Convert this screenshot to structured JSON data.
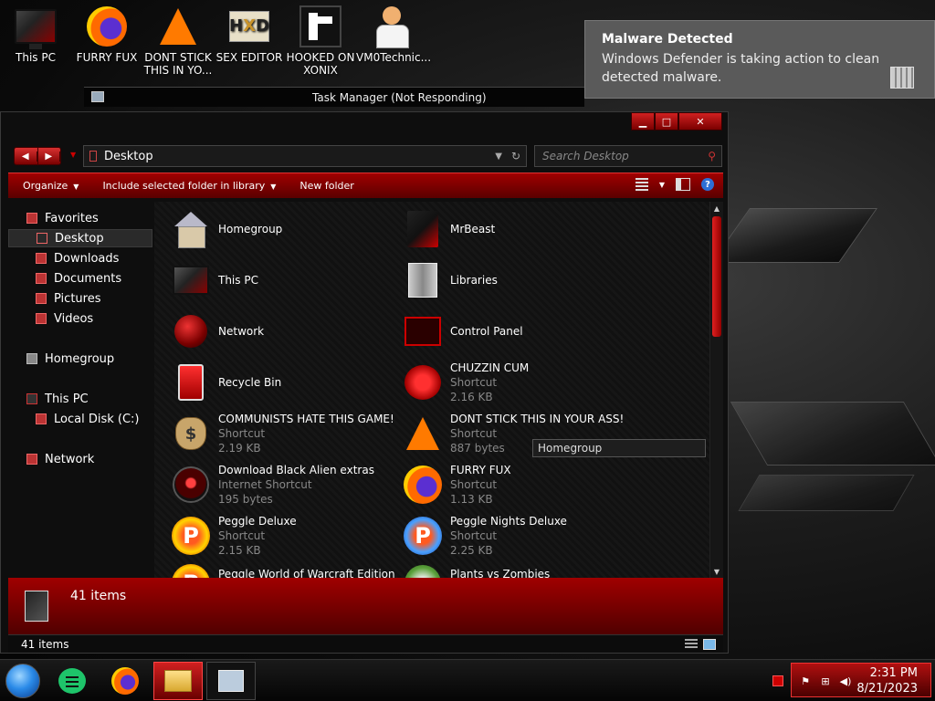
{
  "desktop": {
    "icons": [
      {
        "label": "This PC",
        "icon": "monitor-icon"
      },
      {
        "label": "FURRY FUX",
        "icon": "firefox-icon"
      },
      {
        "label": "DONT STICK THIS IN YO...",
        "icon": "vlc-cone-icon"
      },
      {
        "label": "SEX EDITOR",
        "icon": "hxd-icon"
      },
      {
        "label": "HOOKED ON XONIX",
        "icon": "game-icon"
      },
      {
        "label": "VM0Technic...",
        "icon": "doctor-icon"
      }
    ]
  },
  "notification": {
    "title": "Malware Detected",
    "body": "Windows Defender is taking action to clean detected malware."
  },
  "task_manager": {
    "title": "Task Manager (Not Responding)"
  },
  "explorer": {
    "address": "Desktop",
    "search_placeholder": "Search Desktop",
    "commands": {
      "organize": "Organize",
      "include": "Include selected folder in library",
      "new_folder": "New folder"
    },
    "nav": {
      "favorites": "Favorites",
      "desktop": "Desktop",
      "downloads": "Downloads",
      "documents": "Documents",
      "pictures": "Pictures",
      "videos": "Videos",
      "homegroup": "Homegroup",
      "this_pc": "This PC",
      "local_disk": "Local Disk (C:)",
      "network": "Network"
    },
    "items": [
      {
        "name": "Homegroup",
        "type": "",
        "size": "",
        "icon": "homegroup-icon"
      },
      {
        "name": "MrBeast",
        "type": "",
        "size": "",
        "icon": "mrbeast-icon"
      },
      {
        "name": "This PC",
        "type": "",
        "size": "",
        "icon": "monitor-icon"
      },
      {
        "name": "Libraries",
        "type": "",
        "size": "",
        "icon": "libraries-icon"
      },
      {
        "name": "Network",
        "type": "",
        "size": "",
        "icon": "network-icon"
      },
      {
        "name": "Control Panel",
        "type": "",
        "size": "",
        "icon": "control-panel-icon"
      },
      {
        "name": "Recycle Bin",
        "type": "",
        "size": "",
        "icon": "recycle-bin-icon"
      },
      {
        "name": "CHUZZIN CUM",
        "type": "Shortcut",
        "size": "2.16 KB",
        "icon": "chuzzle-icon"
      },
      {
        "name": "COMMUNISTS HATE THIS GAME!",
        "type": "Shortcut",
        "size": "2.19 KB",
        "icon": "money-bag-icon"
      },
      {
        "name": "DONT STICK THIS IN YOUR ASS!",
        "type": "Shortcut",
        "size": "887 bytes",
        "icon": "vlc-cone-icon"
      },
      {
        "name": "Download Black Alien extras",
        "type": "Internet Shortcut",
        "size": "195 bytes",
        "icon": "alien-icon"
      },
      {
        "name": "FURRY FUX",
        "type": "Shortcut",
        "size": "1.13 KB",
        "icon": "firefox-icon"
      },
      {
        "name": "Peggle Deluxe",
        "type": "Shortcut",
        "size": "2.15 KB",
        "icon": "peggle-icon"
      },
      {
        "name": "Peggle Nights Deluxe",
        "type": "Shortcut",
        "size": "2.25 KB",
        "icon": "peggle-nights-icon"
      },
      {
        "name": "Peggle World of Warcraft Edition",
        "type": "",
        "size": "",
        "icon": "peggle-icon"
      },
      {
        "name": "Plants vs Zombies",
        "type": "",
        "size": "",
        "icon": "pvz-icon"
      }
    ],
    "tooltip": "Homegroup",
    "details_count": "41 items",
    "status_count": "41 items"
  },
  "taskbar": {
    "time": "2:31 PM",
    "date": "8/21/2023"
  }
}
